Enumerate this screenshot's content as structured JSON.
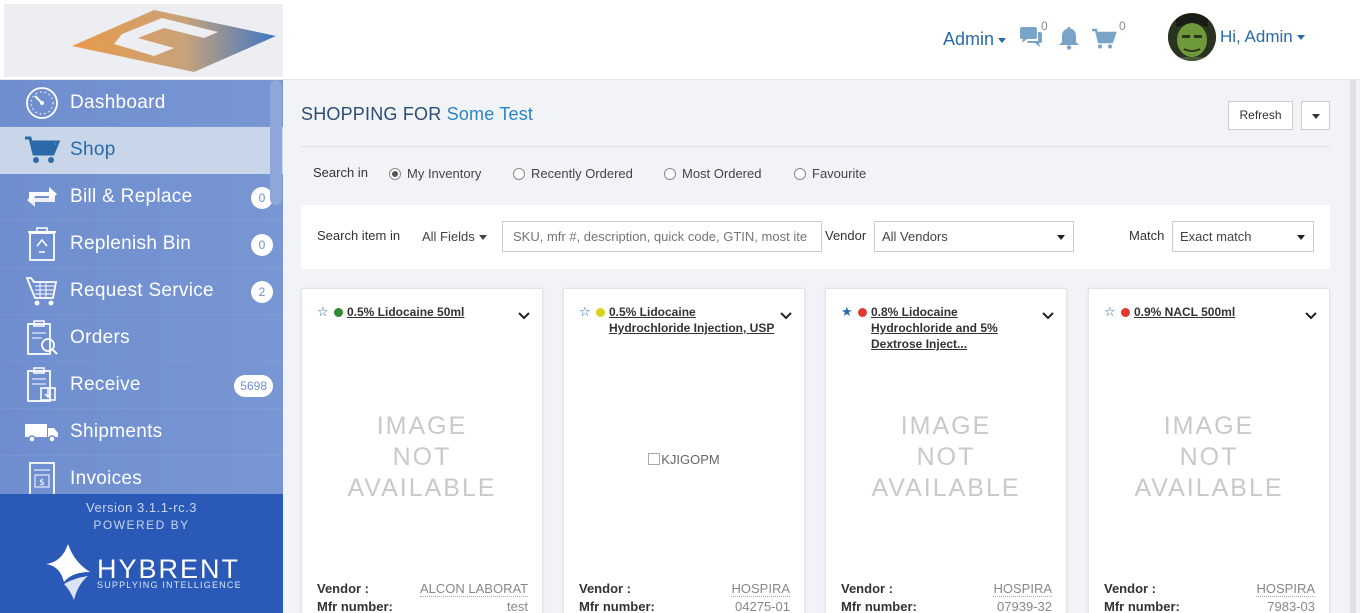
{
  "header": {
    "admin_menu_label": "Admin",
    "messages_count": "0",
    "cart_count": "0",
    "greeting": "Hi, Admin"
  },
  "sidebar": {
    "items": [
      {
        "label": "Dashboard",
        "icon": "dashboard-icon",
        "badge": ""
      },
      {
        "label": "Shop",
        "icon": "cart-icon",
        "badge": "",
        "active": true
      },
      {
        "label": "Bill & Replace",
        "icon": "bill-replace-icon",
        "badge": "0"
      },
      {
        "label": "Replenish Bin",
        "icon": "recycle-bin-icon",
        "badge": "0"
      },
      {
        "label": "Request Service",
        "icon": "request-service-icon",
        "badge": "2"
      },
      {
        "label": "Orders",
        "icon": "orders-icon",
        "badge": ""
      },
      {
        "label": "Receive",
        "icon": "receive-icon",
        "badge": "5698"
      },
      {
        "label": "Shipments",
        "icon": "truck-icon",
        "badge": ""
      },
      {
        "label": "Invoices",
        "icon": "invoice-icon",
        "badge": ""
      }
    ],
    "version": "Version 3.1.1-rc.3",
    "powered_by": "POWERED BY",
    "brand_name": "HYBRENT",
    "brand_tagline": "SUPPLYING INTELLIGENCE"
  },
  "main": {
    "title_prefix": "SHOPPING FOR",
    "title_highlight": "Some Test",
    "refresh_label": "Refresh",
    "search_in_label": "Search in",
    "search_in_options": [
      {
        "label": "My Inventory",
        "selected": true
      },
      {
        "label": "Recently Ordered",
        "selected": false
      },
      {
        "label": "Most Ordered",
        "selected": false
      },
      {
        "label": "Favourite",
        "selected": false
      }
    ],
    "filter": {
      "search_item_in_label": "Search item in",
      "fields_value": "All Fields",
      "search_placeholder": "SKU, mfr #, description, quick code, GTIN, most ite",
      "vendor_label": "Vendor",
      "vendor_value": "All Vendors",
      "match_label": "Match",
      "match_value": "Exact match"
    }
  },
  "cards": [
    {
      "title": "0.5% Lidocaine 50ml",
      "status_color": "#2e8b2e",
      "favourite": false,
      "image": "IMAGE NOT AVAILABLE",
      "vendor_label": "Vendor :",
      "vendor": "ALCON LABORATORIES",
      "mfr_label": "Mfr number:",
      "mfr": "test"
    },
    {
      "title": "0.5% Lidocaine Hydrochloride Injection, USP",
      "status_color": "#d8d21a",
      "favourite": false,
      "image_alt": "KJIGOPM",
      "vendor_label": "Vendor :",
      "vendor": "HOSPIRA",
      "mfr_label": "Mfr number:",
      "mfr": "04275-01"
    },
    {
      "title": "0.8% Lidocaine Hydrochloride and 5% Dextrose Inject...",
      "status_color": "#e03a2f",
      "favourite": true,
      "image": "IMAGE NOT AVAILABLE",
      "vendor_label": "Vendor :",
      "vendor": "HOSPIRA",
      "mfr_label": "Mfr number:",
      "mfr": "07939-32"
    },
    {
      "title": "0.9% NACL 500ml",
      "status_color": "#e03a2f",
      "favourite": false,
      "image": "IMAGE NOT AVAILABLE",
      "vendor_label": "Vendor :",
      "vendor": "HOSPIRA",
      "mfr_label": "Mfr number:",
      "mfr": "7983-03"
    }
  ],
  "image_placeholder_lines": [
    "IMAGE",
    "NOT",
    "AVAILABLE"
  ]
}
